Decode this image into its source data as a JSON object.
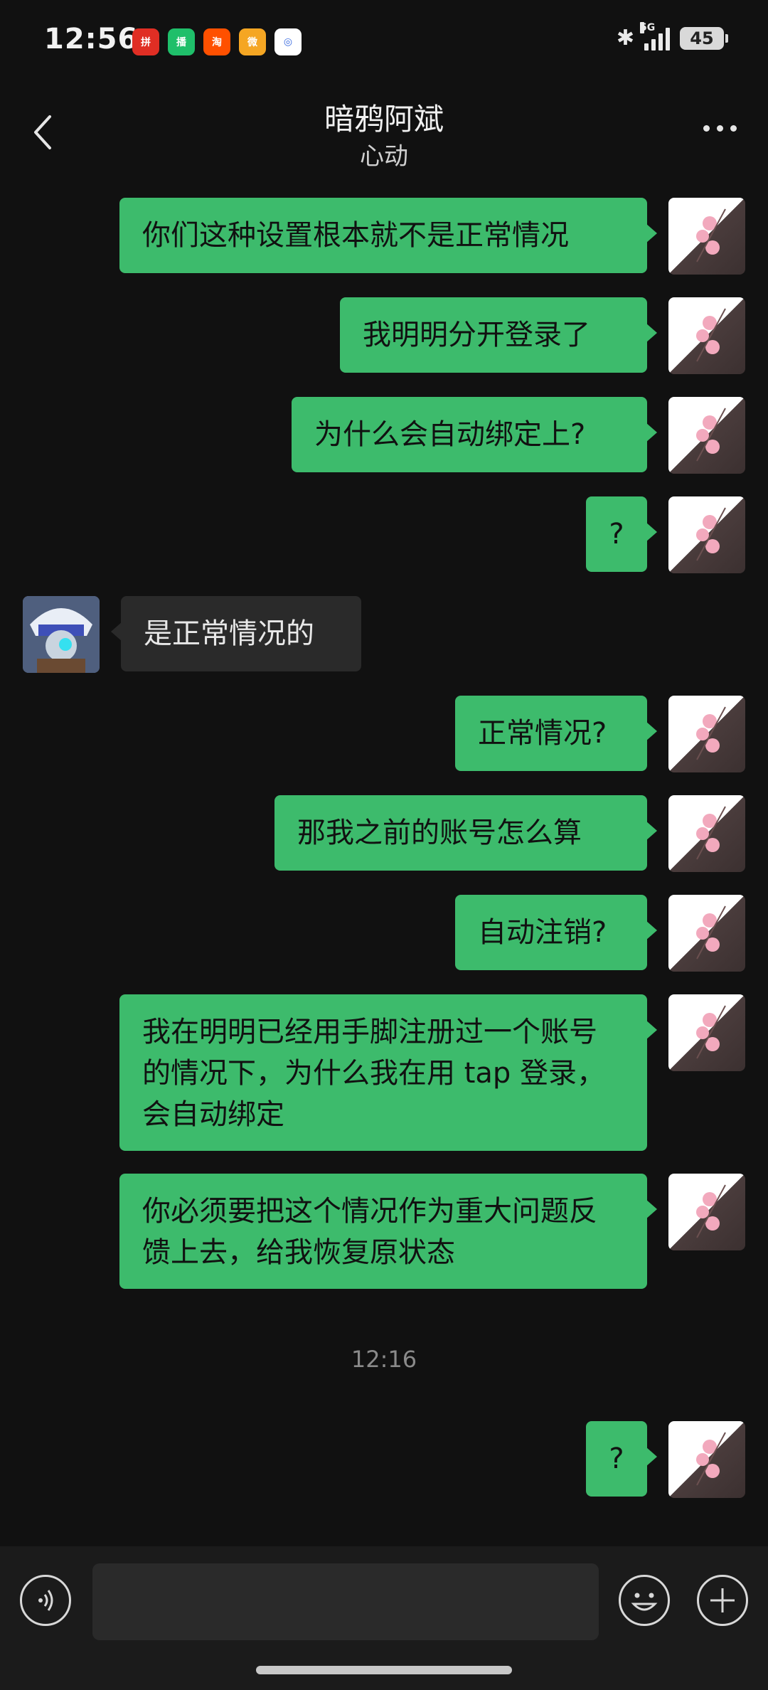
{
  "status_bar": {
    "time": "12:56",
    "network_label": "5G",
    "battery": "45",
    "app_icons": [
      {
        "name": "pinduoduo-icon",
        "label": "拼",
        "color": "#e02e24"
      },
      {
        "name": "bocai-icon",
        "label": "播",
        "color": "#1fbf6a"
      },
      {
        "name": "taobao-icon",
        "label": "淘",
        "color": "#ff5000"
      },
      {
        "name": "weibo-icon",
        "label": "微",
        "color": "#f5a623"
      },
      {
        "name": "cloud-app-icon",
        "label": "◎",
        "color": "#ffffff"
      }
    ]
  },
  "header": {
    "title": "暗鸦阿斌",
    "subtitle": "心动"
  },
  "messages": [
    {
      "dir": "out",
      "text": "你们这种设置根本就不是正常情况"
    },
    {
      "dir": "out",
      "text": "我明明分开登录了"
    },
    {
      "dir": "out",
      "text": "为什么会自动绑定上?"
    },
    {
      "dir": "out",
      "text": "?"
    },
    {
      "dir": "in",
      "text": "是正常情况的"
    },
    {
      "dir": "out",
      "text": "正常情况?"
    },
    {
      "dir": "out",
      "text": "那我之前的账号怎么算"
    },
    {
      "dir": "out",
      "text": "自动注销?"
    },
    {
      "dir": "out",
      "text": "我在明明已经用手脚注册过一个账号的情况下，为什么我在用 tap 登录，会自动绑定"
    },
    {
      "dir": "out",
      "text": "你必须要把这个情况作为重大问题反馈上去，给我恢复原状态"
    },
    {
      "dir": "out",
      "text": "?"
    }
  ],
  "timestamp": "12:16",
  "input": {
    "placeholder": "",
    "value": ""
  },
  "colors": {
    "background": "#111111",
    "outgoing_bubble": "#3dbb6c",
    "incoming_bubble": "#2a2a2a"
  }
}
